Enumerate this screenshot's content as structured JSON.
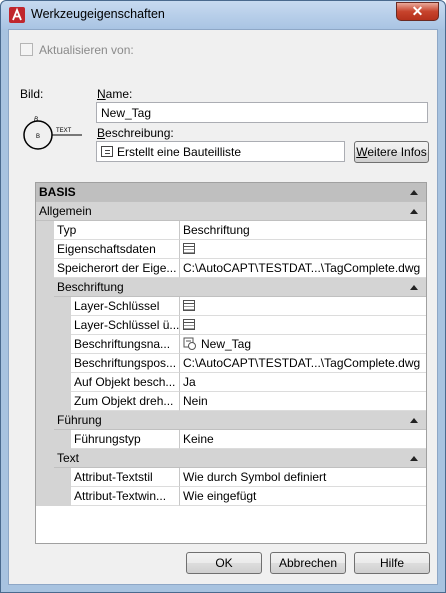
{
  "window": {
    "title": "Werkzeugeigenschaften",
    "close_label": "✕"
  },
  "update_from": {
    "label": "Aktualisieren von:",
    "checked": false
  },
  "image": {
    "label": "Bild:",
    "preview_text": "TEXT",
    "preview_letter": "B"
  },
  "name": {
    "label": "Name:",
    "value": "New_Tag"
  },
  "description": {
    "label": "Beschreibung:",
    "value": "Erstellt eine Bauteilliste",
    "more_button": "Weitere Infos"
  },
  "grid": {
    "basis": "BASIS",
    "allgemein": {
      "header": "Allgemein",
      "rows": [
        {
          "name": "Typ",
          "value": "Beschriftung"
        },
        {
          "name": "Eigenschaftsdaten",
          "value": ""
        },
        {
          "name": "Speicherort der Eige...",
          "value": "C:\\AutoCAPT\\TESTDAT...\\TagComplete.dwg"
        }
      ]
    },
    "beschriftung": {
      "header": "Beschriftung",
      "rows": [
        {
          "name": "Layer-Schlüssel",
          "value": ""
        },
        {
          "name": "Layer-Schlüssel ü...",
          "value": ""
        },
        {
          "name": "Beschriftungsna...",
          "value": "New_Tag"
        },
        {
          "name": "Beschriftungspos...",
          "value": "C:\\AutoCAPT\\TESTDAT...\\TagComplete.dwg"
        },
        {
          "name": "Auf Objekt besch...",
          "value": "Ja"
        },
        {
          "name": "Zum Objekt dreh...",
          "value": "Nein"
        }
      ]
    },
    "fuehrung": {
      "header": "Führung",
      "rows": [
        {
          "name": "Führungstyp",
          "value": "Keine"
        }
      ]
    },
    "text": {
      "header": "Text",
      "rows": [
        {
          "name": "Attribut-Textstil",
          "value": "Wie durch Symbol definiert"
        },
        {
          "name": "Attribut-Textwin...",
          "value": "Wie eingefügt"
        }
      ]
    }
  },
  "buttons": {
    "ok": "OK",
    "cancel": "Abbrechen",
    "help": "Hilfe"
  }
}
